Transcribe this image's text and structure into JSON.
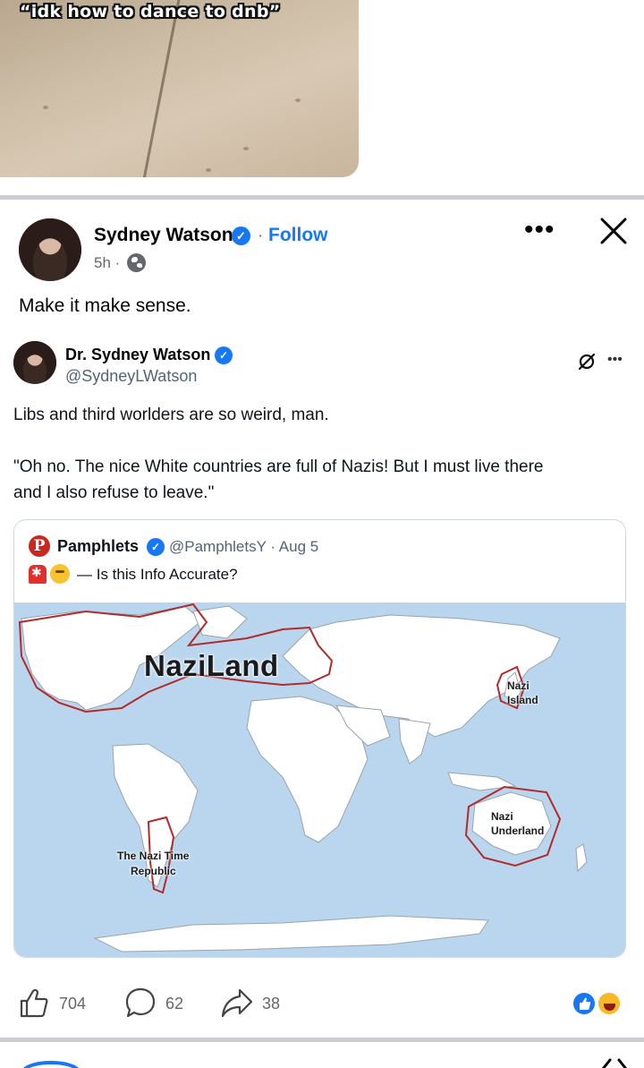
{
  "previous_post": {
    "meme_caption": "“idk how to dance to dnb”"
  },
  "post": {
    "author": "Sydney Watson",
    "follow_label": "Follow",
    "time": "5h",
    "text": "Make it make sense."
  },
  "embedded_post": {
    "author": "Dr. Sydney Watson",
    "handle": "@SydneyLWatson",
    "line1": "Libs and third worlders are so weird, man.",
    "line2": "\"Oh no. The nice White countries are full of Nazis! But I must live there",
    "line3": "and I also refuse to leave.\"",
    "quoted": {
      "logo_letter": "P",
      "author": "Pamphlets",
      "handle_date": "@PamphletsY · Aug 5",
      "text": "— Is this Info Accurate?",
      "map_labels": {
        "naziland": "NaziLand",
        "nazi_island_1": "Nazi",
        "nazi_island_2": "Island",
        "nazi_underland_1": "Nazi",
        "nazi_underland_2": "Underland",
        "nazi_time_1": "The Nazi Time",
        "nazi_time_2": "Republic"
      }
    }
  },
  "reactions": {
    "likes": "704",
    "comments": "62",
    "shares": "38"
  },
  "colors": {
    "brand_blue": "#1877f2",
    "divider": "#c9ccd1",
    "ocean": "#b9d6ee",
    "border_red": "#b22b2b"
  }
}
